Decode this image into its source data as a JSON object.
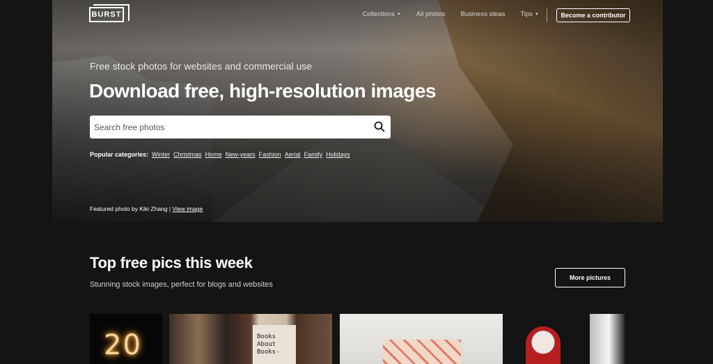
{
  "nav": {
    "logo": "BURST",
    "links": [
      "Collections",
      "All photos",
      "Business ideas",
      "Tips"
    ],
    "contributor_button": "Become a contributor"
  },
  "hero": {
    "tagline": "Free stock photos for websites and commercial use",
    "headline": "Download free, high-resolution images",
    "search_placeholder": "Search free photos",
    "categories_label": "Popular categories:",
    "categories": [
      "Winter",
      "Christmas",
      "Home",
      "New-years",
      "Fashion",
      "Aerial",
      "Family",
      "Holidays"
    ],
    "featured_text": "Featured photo by Kiki Zhang |",
    "featured_link": "View image"
  },
  "section": {
    "title": "Top free pics this week",
    "subtitle": "Stunning stock images, perfect for blogs and websites",
    "more_button": "More pictures"
  },
  "thumbnails": {
    "t1_text": "20",
    "t2_text": "Books\nAbout\nBooks-"
  },
  "colors": {
    "background": "#141414",
    "text": "#ffffff"
  }
}
